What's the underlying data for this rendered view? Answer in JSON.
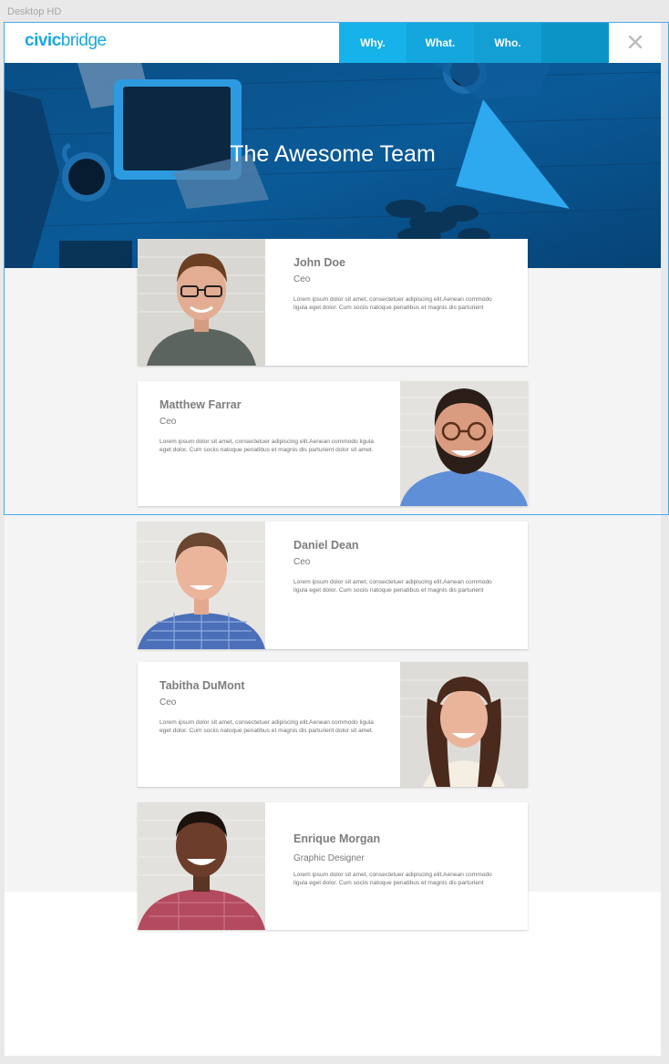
{
  "artboard_label": "Desktop HD",
  "brand": {
    "logo_bold": "civic",
    "logo_light": "bridge",
    "accent": "#1aa7df"
  },
  "nav": {
    "items": [
      "Why.",
      "What.",
      "Who.",
      ""
    ],
    "close_icon": "close-icon"
  },
  "hero": {
    "title": "The Awesome Team",
    "overlay_color": "#004e8a"
  },
  "team": [
    {
      "name": "John Doe",
      "role": "Ceo",
      "bio": "Lorem ipsum dolor sit amet, consectetuer adipiscing elit.Aenean commodo ligula eget dolor. Cum sociis natoque penatibus et magnis dis parturient"
    },
    {
      "name": "Matthew Farrar",
      "role": "Ceo",
      "bio": "Lorem ipsum dolor sit amet, consectetuer adipiscing elit.Aenean commodo ligula eget dolor. Cum sociis natoque penatibus et magnis dis parturient dolor sit amet."
    },
    {
      "name": "Daniel Dean",
      "role": "Ceo",
      "bio": "Lorem ipsum dolor sit amet, consectetuer adipiscing elit.Aenean commodo ligula eget dolor. Cum sociis natoque penatibus et magnis dis parturient"
    },
    {
      "name": "Tabitha DuMont",
      "role": "Ceo",
      "bio": "Lorem ipsum dolor sit amet, consectetuer adipiscing elit.Aenean commodo ligula eget dolor. Cum sociis natoque penatibus et magnis dis parturient dolor sit amet."
    },
    {
      "name": "Enrique Morgan",
      "role": "Graphic Designer",
      "bio": "Lorem ipsum dolor sit amet, consectetuer adipiscing elit.Aenean commodo ligula eget dolor. Cum sociis natoque penatibus et magnis dis parturient"
    }
  ]
}
